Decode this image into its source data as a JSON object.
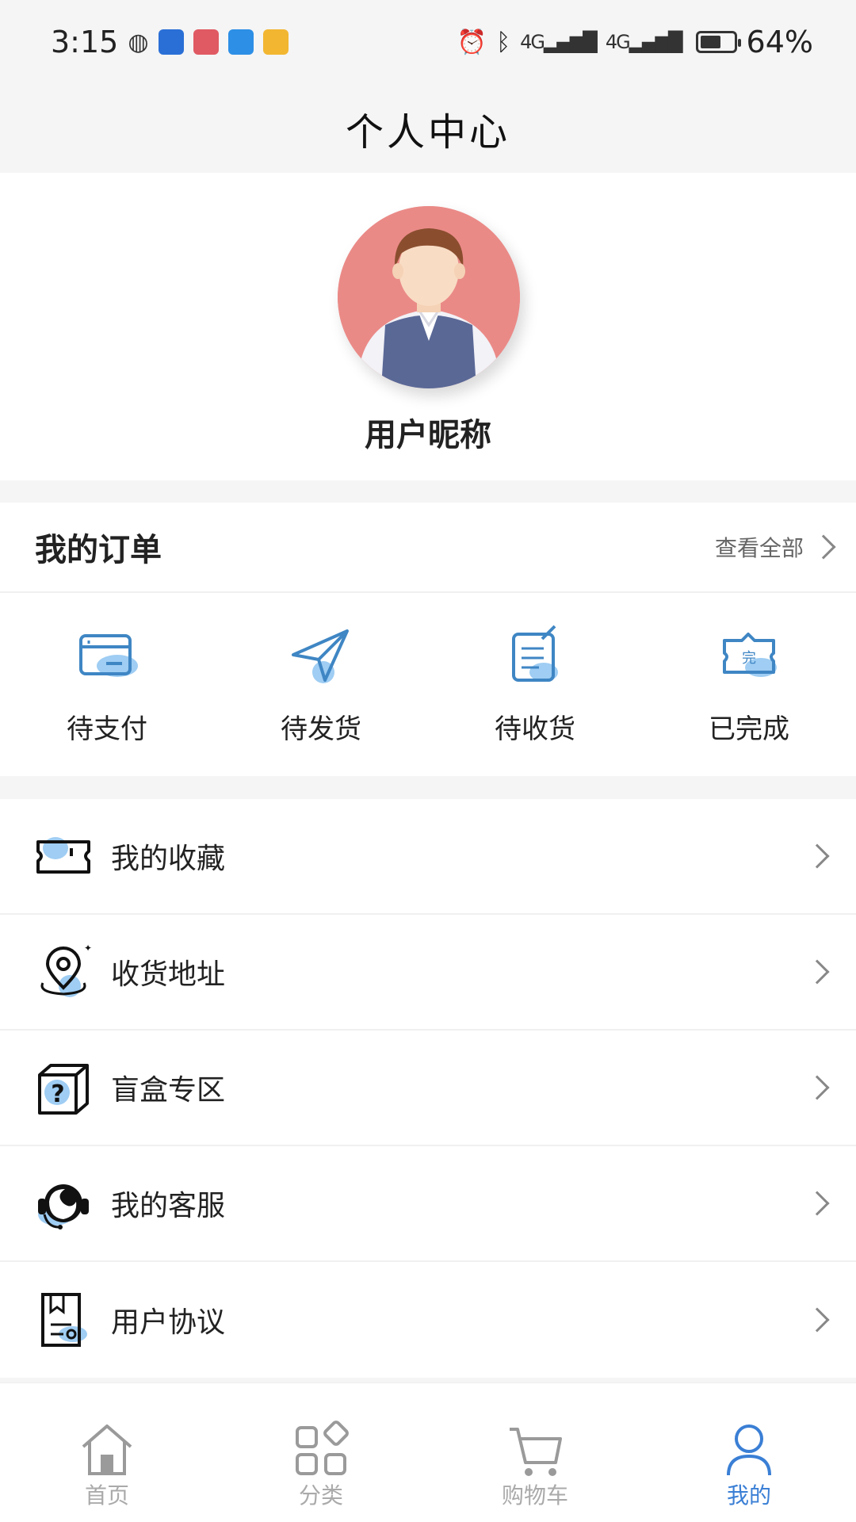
{
  "status_bar": {
    "time": "3:15",
    "network_1": "4G",
    "network_2": "4G",
    "battery_percent": "64%",
    "battery_level": 0.64,
    "notification_icons": [
      "wechat-icon",
      "app-blue-icon",
      "app-red-icon",
      "weather-icon",
      "app-yellow-icon"
    ]
  },
  "header": {
    "title": "个人中心"
  },
  "profile": {
    "nickname": "用户昵称"
  },
  "orders": {
    "title": "我的订单",
    "view_all": "查看全部",
    "items": [
      {
        "label": "待支付",
        "icon": "card-icon"
      },
      {
        "label": "待发货",
        "icon": "paper-plane-icon"
      },
      {
        "label": "待收货",
        "icon": "document-edit-icon"
      },
      {
        "label": "已完成",
        "icon": "completed-ticket-icon"
      }
    ]
  },
  "menu": {
    "items": [
      {
        "label": "我的收藏",
        "icon": "ticket-icon"
      },
      {
        "label": "收货地址",
        "icon": "location-pin-icon"
      },
      {
        "label": "盲盒专区",
        "icon": "mystery-box-icon"
      },
      {
        "label": "我的客服",
        "icon": "headset-icon"
      },
      {
        "label": "用户协议",
        "icon": "agreement-icon"
      }
    ]
  },
  "tabbar": {
    "items": [
      {
        "label": "首页",
        "icon": "home-icon",
        "active": false
      },
      {
        "label": "分类",
        "icon": "category-icon",
        "active": false
      },
      {
        "label": "购物车",
        "icon": "cart-icon",
        "active": false
      },
      {
        "label": "我的",
        "icon": "user-icon",
        "active": true
      }
    ]
  },
  "colors": {
    "accent": "#3a7fd5",
    "icon_light_blue": "#9fcdf3",
    "icon_stroke": "#3f86c4",
    "avatar_bg": "#ea8a87",
    "inactive_tab": "#aaaaaa"
  }
}
